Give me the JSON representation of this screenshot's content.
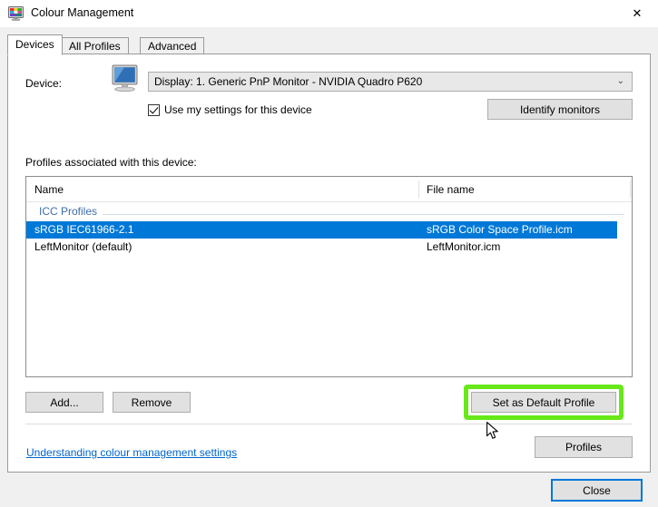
{
  "window": {
    "title": "Colour Management",
    "icon": "colour-management-monitor-icon",
    "close_glyph": "✕"
  },
  "tabs": [
    {
      "label": "Devices",
      "selected": true
    },
    {
      "label": "All Profiles",
      "selected": false
    },
    {
      "label": "Advanced",
      "selected": false
    }
  ],
  "device": {
    "label": "Device:",
    "icon": "monitor-icon",
    "selected_value": "Display: 1. Generic PnP Monitor - NVIDIA Quadro P620",
    "dropdown_glyph": "⌄",
    "use_my_settings_label": "Use my settings for this device",
    "use_my_settings_checked": true,
    "identify_monitors_label": "Identify monitors"
  },
  "profiles": {
    "section_label": "Profiles associated with this device:",
    "columns": [
      "Name",
      "File name"
    ],
    "group_label": "ICC Profiles",
    "rows": [
      {
        "name": "sRGB IEC61966-2.1",
        "file": "sRGB Color Space Profile.icm",
        "selected": true
      },
      {
        "name": "LeftMonitor (default)",
        "file": "LeftMonitor.icm",
        "selected": false
      }
    ],
    "add_label": "Add...",
    "remove_label": "Remove",
    "set_default_label": "Set as Default Profile"
  },
  "footer": {
    "link_label": "Understanding colour management settings",
    "profiles_label": "Profiles",
    "close_label": "Close"
  },
  "colors": {
    "selection_blue": "#0078D7",
    "highlight_green": "#68E819",
    "group_text_blue": "#3F6FA8",
    "link_blue": "#0066CC",
    "window_grey": "#F0F0F0",
    "button_face": "#E1E1E1"
  }
}
